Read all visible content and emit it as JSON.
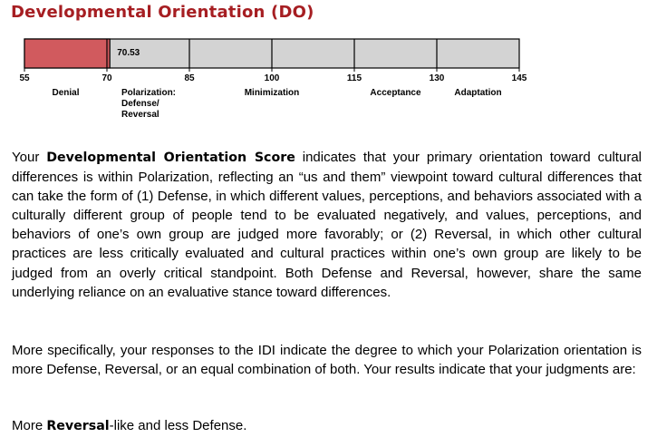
{
  "title": "Developmental Orientation (DO)",
  "chart_data": {
    "type": "bar",
    "orientation": "horizontal",
    "xlim": [
      55,
      145
    ],
    "ticks": [
      55,
      70,
      85,
      100,
      115,
      130,
      145
    ],
    "value": 70.53,
    "value_label": "70.53",
    "bar_color": "#d15a5e",
    "track_color": "#d3d3d3",
    "categories": [
      {
        "label": "Denial",
        "start": 55,
        "end": 70
      },
      {
        "label": "Polarization:\nDefense/\nReversal",
        "start": 70,
        "end": 85
      },
      {
        "label": "Minimization",
        "start": 85,
        "end": 115
      },
      {
        "label": "Acceptance",
        "start": 115,
        "end": 130
      },
      {
        "label": "Adaptation",
        "start": 130,
        "end": 145
      }
    ]
  },
  "paragraph1": {
    "pre": "Your ",
    "bold": "Developmental Orientation Score",
    "post": " indicates that your primary orientation toward cultural differences is within Polarization, reflecting an “us and them” viewpoint toward cultural differences that can take the form of (1) Defense, in which different values, perceptions, and behaviors associated with a culturally different group of people tend to be evaluated negatively, and values, perceptions, and behaviors of one’s own group are judged more favorably; or (2) Reversal, in which other cultural practices are less critically evaluated and cultural practices within one’s own group are likely to be judged from an overly critical standpoint. Both Defense and Reversal, however, share the same underlying reliance on an evaluative stance toward differences."
  },
  "paragraph2": "More specifically, your responses to the IDI indicate the degree to which your Polarization orientation is more Defense, Reversal, or an equal combination of both. Your results indicate that your judgments are:",
  "paragraph3": {
    "pre": "More ",
    "bold": "Reversal",
    "post": "-like and less Defense."
  }
}
